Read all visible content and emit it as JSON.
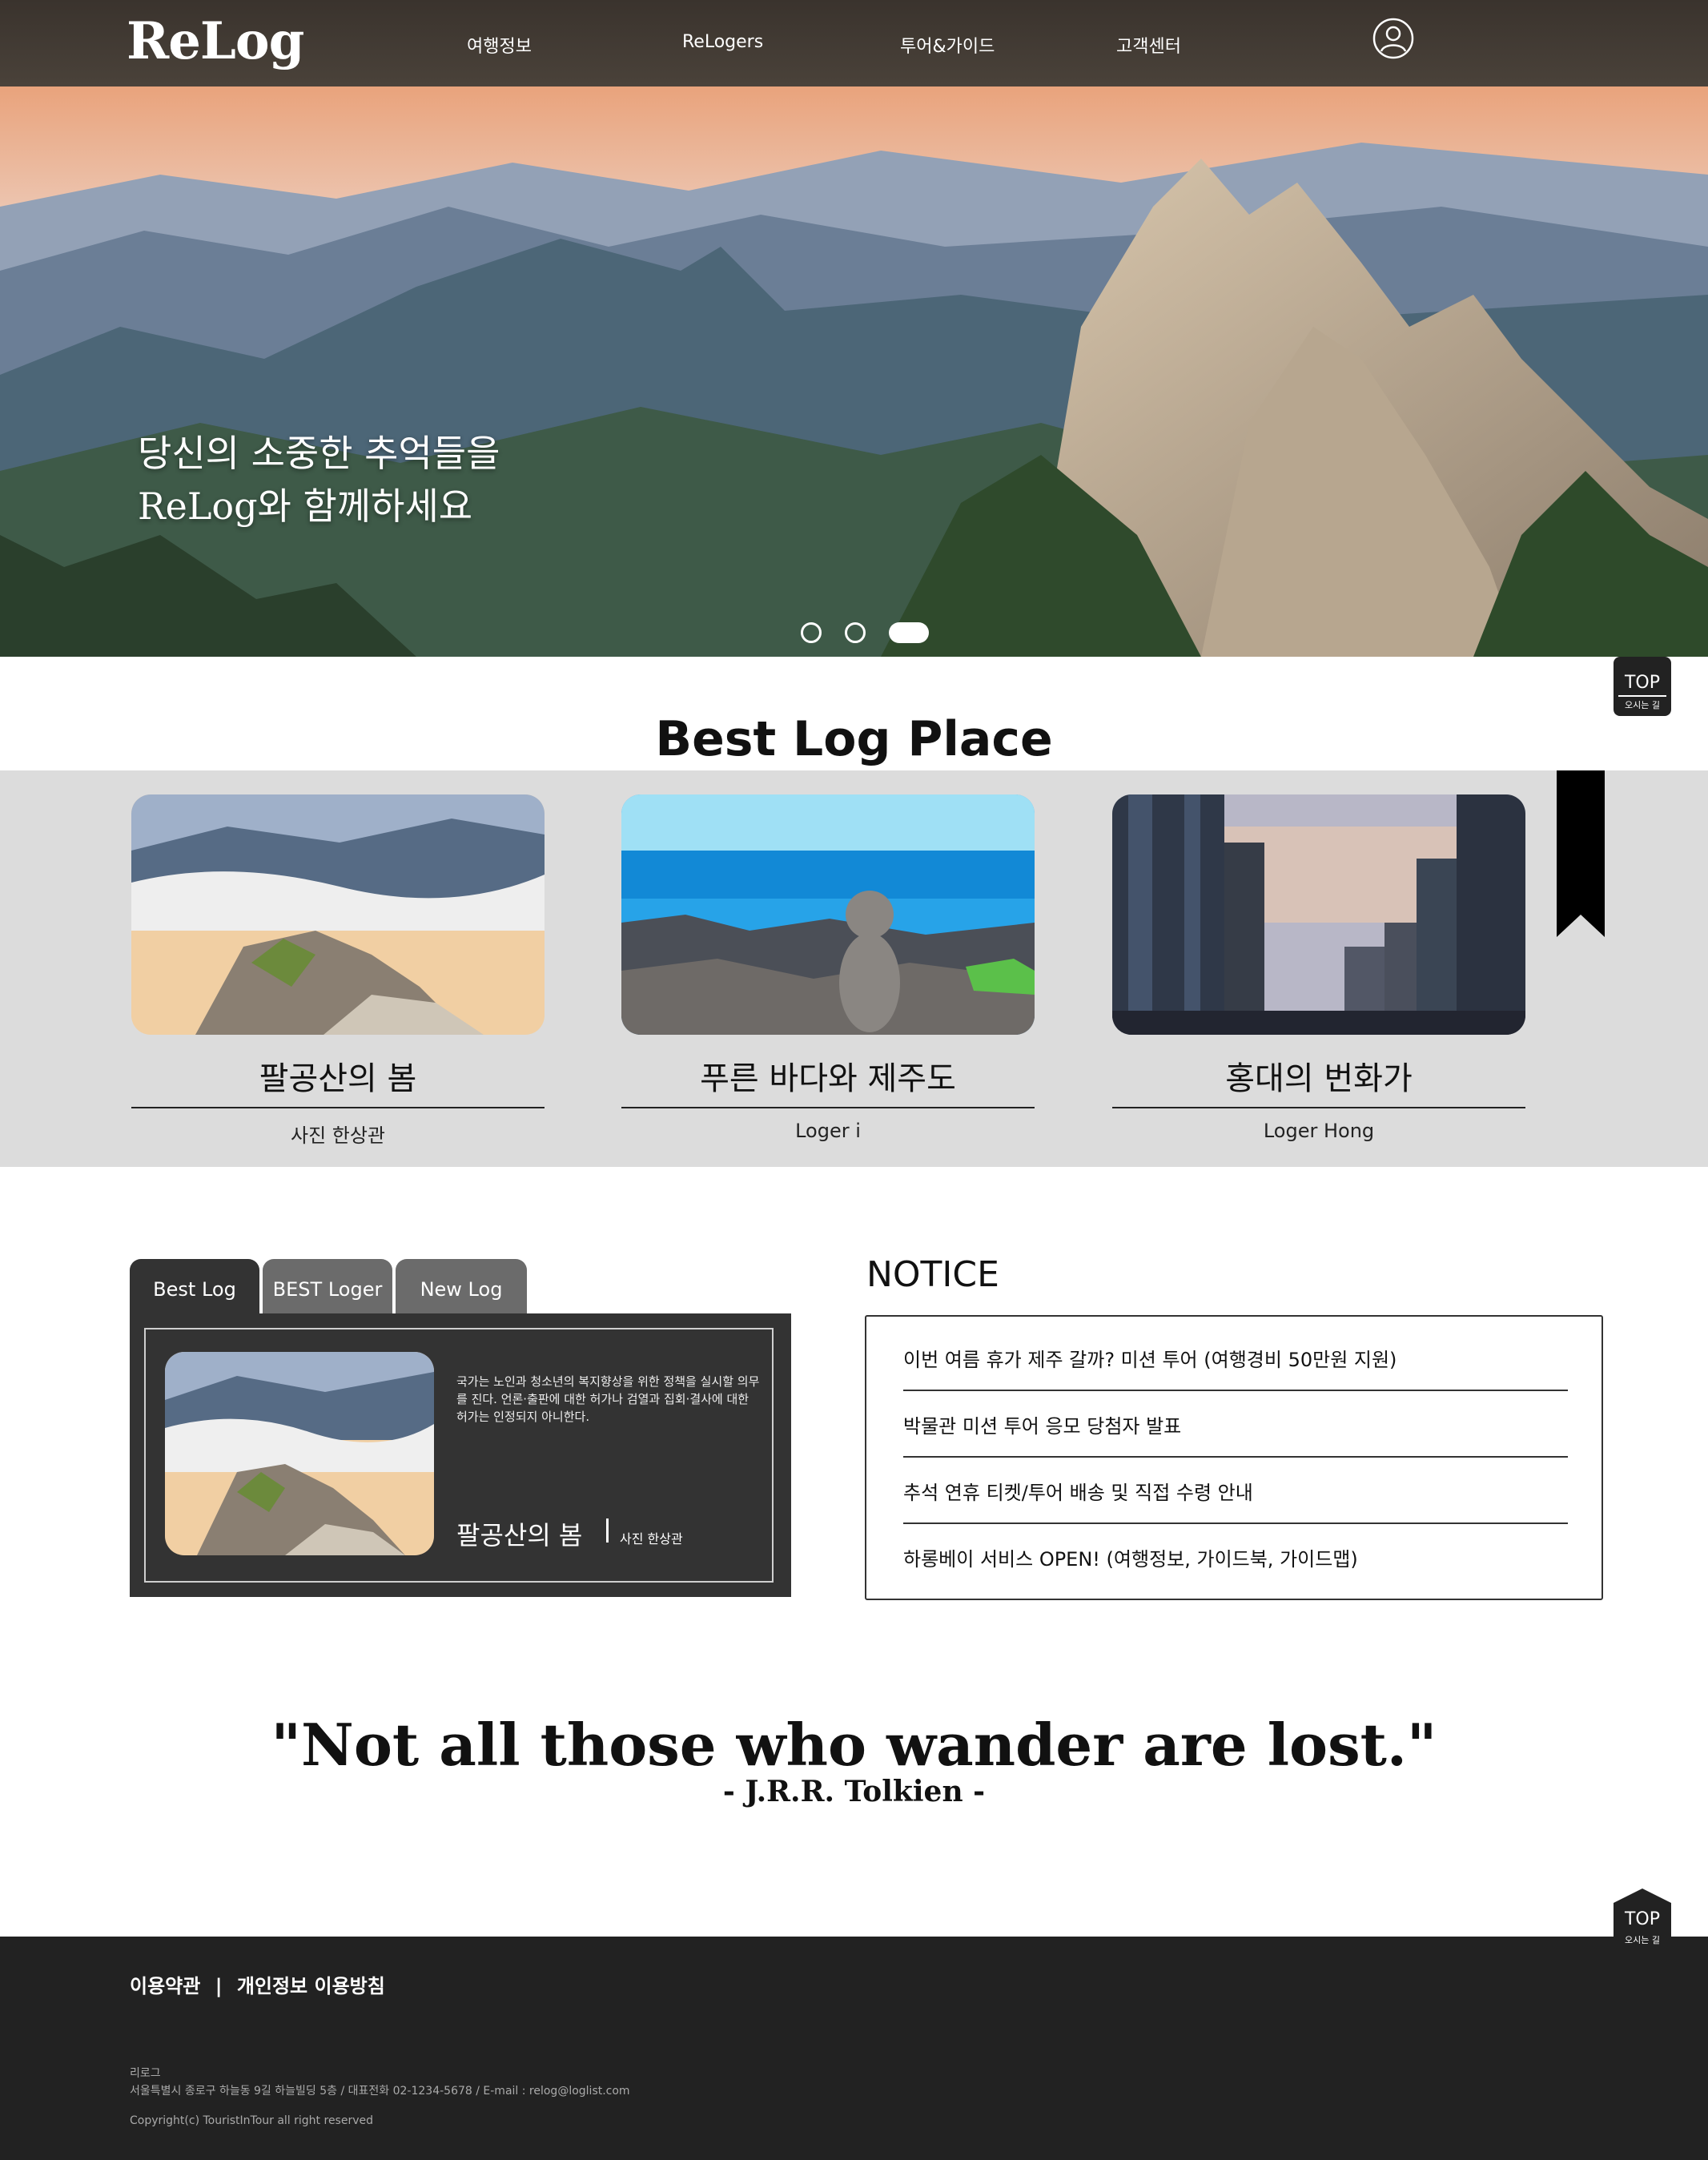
{
  "header": {
    "logo": "ReLog",
    "nav": [
      "여행정보",
      "ReLogers",
      "투어&가이드",
      "고객센터"
    ]
  },
  "hero": {
    "line1": "당신의 소중한 추억들을",
    "line2": "ReLog와 함께하세요",
    "slides_total": 3,
    "active_slide": 3
  },
  "top_button": {
    "label": "TOP",
    "sub": "오시는 길"
  },
  "best_place": {
    "title": "Best Log Place",
    "cards": [
      {
        "title": "팔공산의 봄",
        "author": "사진 한상관"
      },
      {
        "title": "푸른 바다와 제주도",
        "author": "Loger i"
      },
      {
        "title": "홍대의 번화가",
        "author": "Loger Hong"
      }
    ]
  },
  "tabs": {
    "items": [
      "Best Log",
      "BEST Loger",
      "New Log"
    ],
    "active": "Best Log",
    "content": {
      "description": "국가는 노인과 청소년의 복지향상을 위한 정책을 실시할 의무를 진다. 언론·출판에 대한 허가나 검열과 집회·결사에 대한 허가는 인정되지 아니한다.",
      "title": "팔공산의 봄",
      "author": "사진 한상관"
    }
  },
  "notice": {
    "title": "NOTICE",
    "items": [
      "이번 여름 휴가 제주 갈까? 미션 투어 (여행경비 50만원 지원)",
      "박물관 미션 투어 응모 당첨자 발표",
      "추석 연휴 티켓/투어 배송 및 직접 수령 안내",
      "하롱베이 서비스 OPEN! (여행정보, 가이드북, 가이드맵)"
    ]
  },
  "quote": {
    "text": "\"Not all those who wander are lost.\"",
    "author": "- J.R.R. Tolkien -"
  },
  "footer": {
    "link1": "이용약관",
    "separator": "|",
    "link2": "개인정보 이용방침",
    "company": "리로그",
    "address": "서울특별시 종로구 하늘동 9길 하늘빌딩 5층 / 대표전화 02-1234-5678 / E-mail : relog@loglist.com",
    "copyright": "Copyright(c) TouristInTour all right reserved"
  },
  "colors": {
    "header_bg": "#3f3832",
    "band_gray": "#dcdcdc",
    "panel_dark": "#333333",
    "footer_bg": "#222222"
  }
}
